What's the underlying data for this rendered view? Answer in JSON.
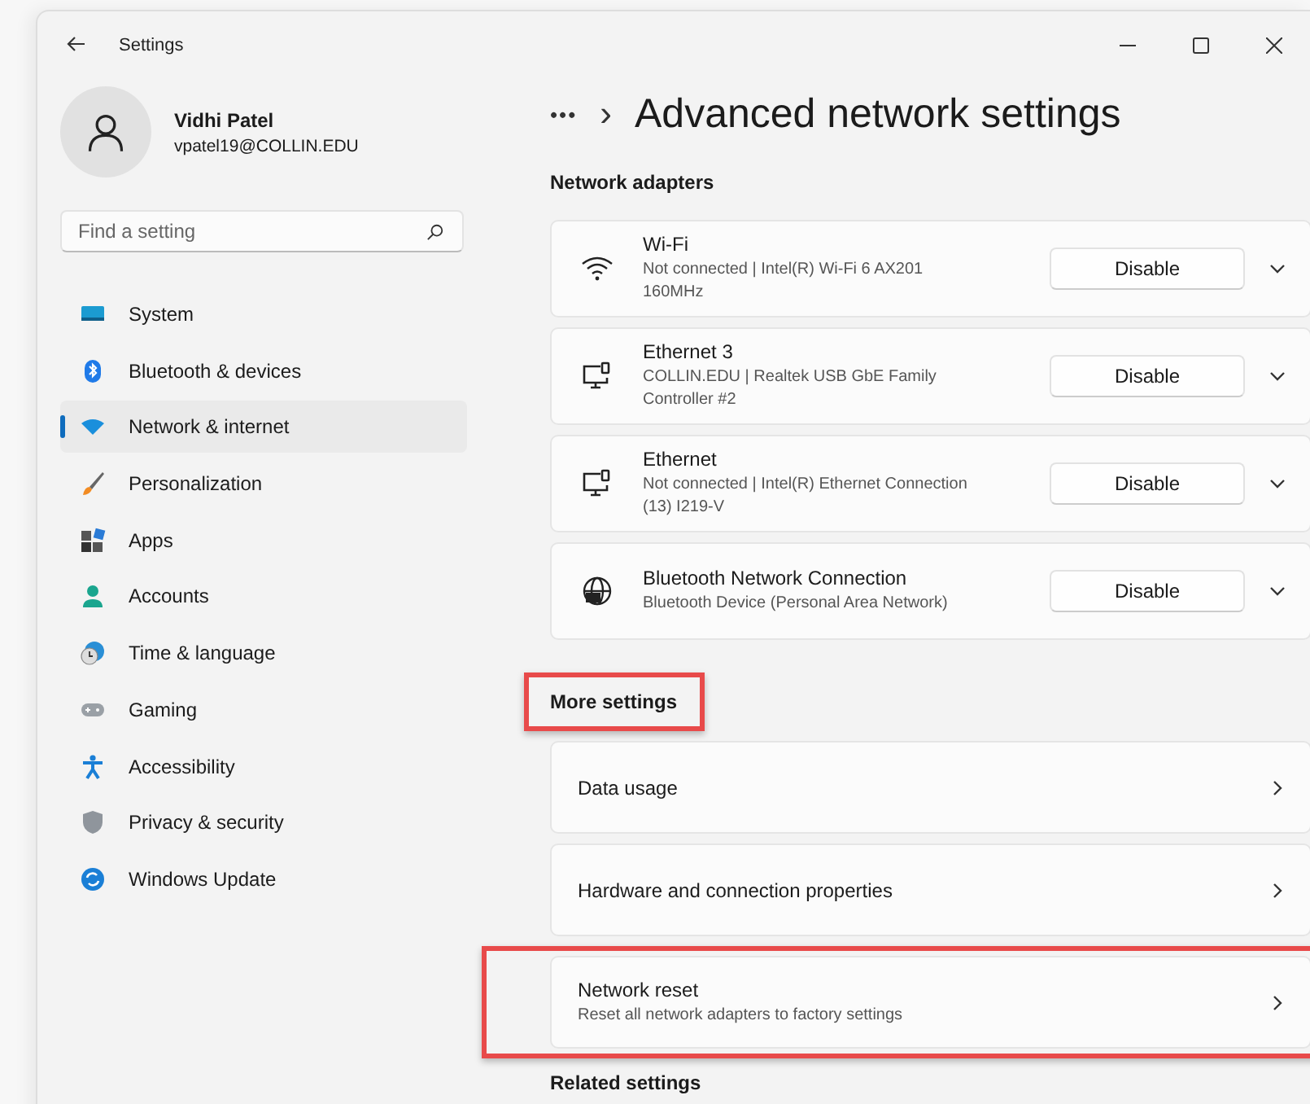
{
  "window": {
    "title": "Settings"
  },
  "profile": {
    "name": "Vidhi Patel",
    "email": "vpatel19@COLLIN.EDU"
  },
  "search": {
    "placeholder": "Find a setting"
  },
  "sidebar": {
    "items": [
      {
        "label": "System",
        "selected": false
      },
      {
        "label": "Bluetooth & devices",
        "selected": false
      },
      {
        "label": "Network & internet",
        "selected": true
      },
      {
        "label": "Personalization",
        "selected": false
      },
      {
        "label": "Apps",
        "selected": false
      },
      {
        "label": "Accounts",
        "selected": false
      },
      {
        "label": "Time & language",
        "selected": false
      },
      {
        "label": "Gaming",
        "selected": false
      },
      {
        "label": "Accessibility",
        "selected": false
      },
      {
        "label": "Privacy & security",
        "selected": false
      },
      {
        "label": "Windows Update",
        "selected": false
      }
    ]
  },
  "breadcrumb": {
    "ellipsis": "•••",
    "separator": "›",
    "title": "Advanced network settings"
  },
  "sections": [
    {
      "heading": "Network adapters",
      "highlighted": false,
      "items": [
        {
          "kind": "adapter",
          "title": "Wi-Fi",
          "subtitle": "Not connected | Intel(R) Wi-Fi 6 AX201 160MHz",
          "button": "Disable",
          "expanded": false,
          "highlighted": false
        },
        {
          "kind": "adapter",
          "title": "Ethernet 3",
          "subtitle": "COLLIN.EDU | Realtek USB GbE Family Controller #2",
          "button": "Disable",
          "expanded": false,
          "highlighted": false
        },
        {
          "kind": "adapter",
          "title": "Ethernet",
          "subtitle": "Not connected | Intel(R) Ethernet Connection (13) I219-V",
          "button": "Disable",
          "expanded": false,
          "highlighted": false
        },
        {
          "kind": "adapter",
          "title": "Bluetooth Network Connection",
          "subtitle": "Bluetooth Device (Personal Area Network)",
          "button": "Disable",
          "expanded": false,
          "highlighted": false
        }
      ]
    },
    {
      "heading": "More settings",
      "highlighted": true,
      "items": [
        {
          "kind": "link",
          "title": "Data usage",
          "highlighted": false
        },
        {
          "kind": "link",
          "title": "Hardware and connection properties",
          "highlighted": false
        },
        {
          "kind": "link",
          "title": "Network reset",
          "subtitle": "Reset all network adapters to factory settings",
          "highlighted": true
        }
      ]
    }
  ],
  "related_heading": "Related settings"
}
